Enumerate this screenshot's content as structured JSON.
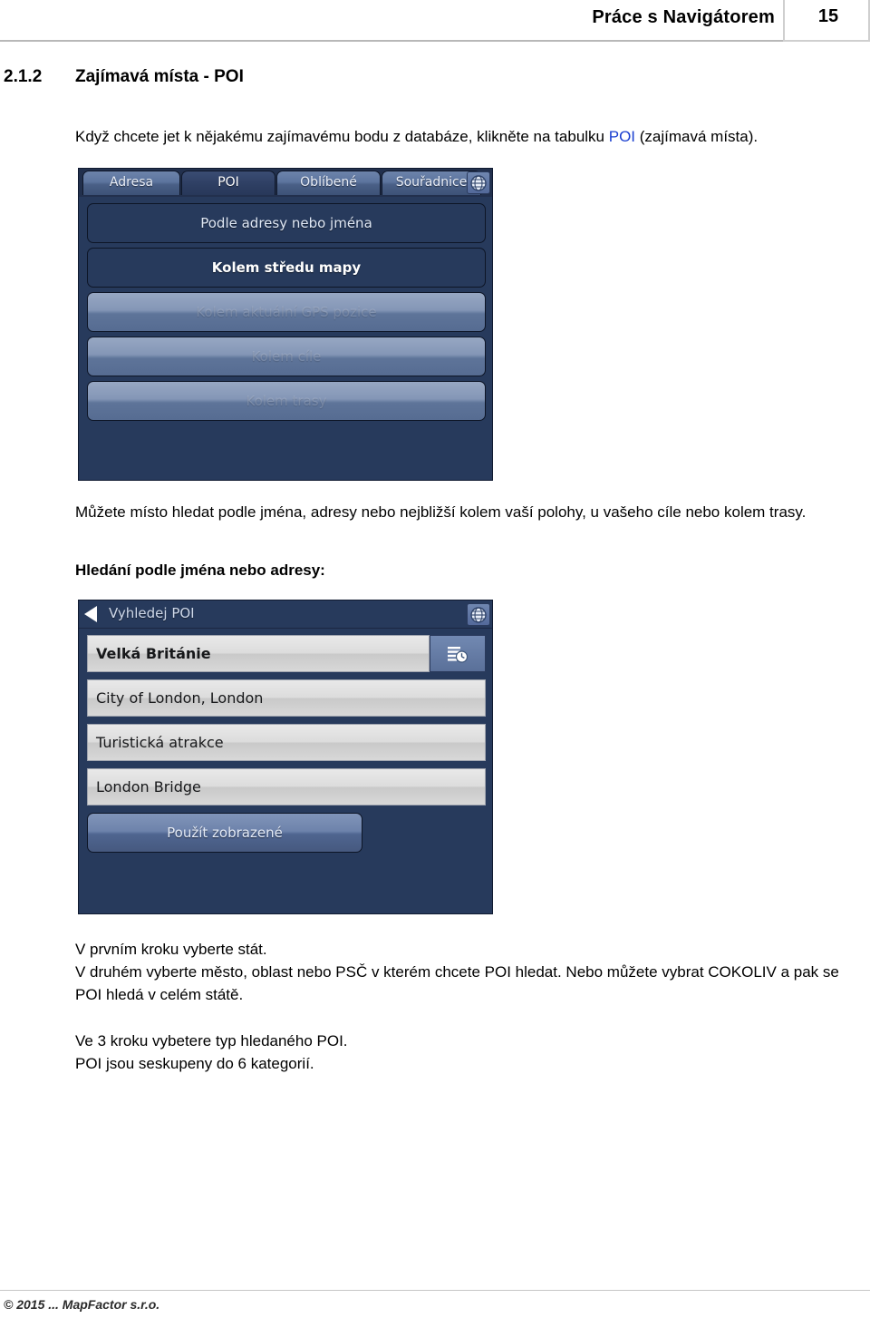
{
  "header": {
    "title": "Práce s Navigátorem",
    "page_number": "15"
  },
  "section": {
    "number": "2.1.2",
    "title": "Zajímavá místa - POI"
  },
  "intro": {
    "before_link": "Když chcete jet k nějakému zajímavému bodu z databáze, klikněte na tabulku ",
    "link": "POI",
    "after_link": " (zajímavá místa)."
  },
  "screenshot_poi_tab": {
    "tabs": [
      {
        "label": "Adresa",
        "active": false
      },
      {
        "label": "POI",
        "active": true
      },
      {
        "label": "Oblíbené",
        "active": false
      },
      {
        "label": "Souřadnice",
        "active": false
      }
    ],
    "globe_icon": "globe-icon",
    "buttons": [
      {
        "label": "Podle adresy nebo jména",
        "state": "enabled",
        "bold": false
      },
      {
        "label": "Kolem středu mapy",
        "state": "enabled",
        "bold": true
      },
      {
        "label": "Kolem aktuální GPS pozice",
        "state": "disabled",
        "bold": false
      },
      {
        "label": "Kolem cíle",
        "state": "disabled",
        "bold": false
      },
      {
        "label": "Kolem trasy",
        "state": "disabled",
        "bold": false
      }
    ]
  },
  "mid_text": {
    "paragraph": "Můžete místo hledat podle jména,  adresy nebo nejbližší kolem vaší polohy, u vašeho cíle nebo kolem trasy.",
    "subheading": "Hledání podle jména nebo adresy:"
  },
  "screenshot_search_poi": {
    "titlebar": {
      "back_icon": "back-arrow-icon",
      "title": "Vyhledej POI",
      "globe_icon": "globe-icon"
    },
    "rows": [
      {
        "label": "Velká Británie",
        "selected": true,
        "has_history_button": true
      },
      {
        "label": "City of London, London",
        "selected": false,
        "has_history_button": false
      },
      {
        "label": "Turistická atrakce",
        "selected": false,
        "has_history_button": false
      },
      {
        "label": "London Bridge",
        "selected": false,
        "has_history_button": false
      }
    ],
    "history_icon": "history-clock-icon",
    "apply_button": "Použít zobrazené"
  },
  "bottom_text": {
    "line1": "V prvním kroku vyberte stát.",
    "line2": "V druhém vyberte město, oblast nebo PSČ v kterém chcete POI hledat. Nebo můžete vybrat COKOLIV a pak se POI hledá v celém státě.",
    "line3": "Ve 3 kroku vybetere typ hledaného POI.",
    "line4": "POI jsou seskupeny do 6 kategorií."
  },
  "footer": {
    "text": "© 2015 ... MapFactor s.r.o."
  },
  "colors": {
    "link": "#1a3fd0",
    "device_background": "#273a5c",
    "device_button": "#6d82ab",
    "list_row": "#dcdcdc"
  }
}
